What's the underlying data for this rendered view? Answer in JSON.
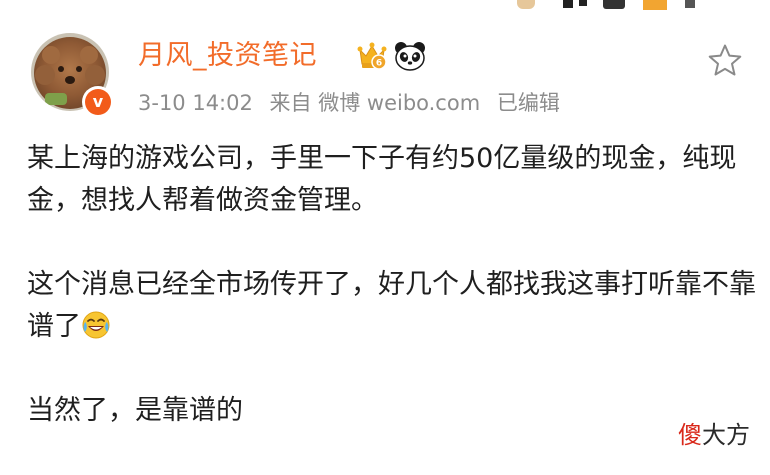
{
  "post": {
    "username": "月风_投资笔记",
    "meta": {
      "time": "3-10 14:02",
      "source": "来自 微博 weibo.com",
      "edited": "已编辑"
    },
    "verified_badge_text": "v",
    "paragraphs": [
      {
        "text": "某上海的游戏公司，手里一下子有约50亿量级的现金，纯现金，想找人帮着做资金管理。"
      },
      {
        "text": "这个消息已经全市场传开了，好几个人都找我这事打听靠不靠谱了",
        "emoji": "laughing-tears-emoji"
      },
      {
        "text": "当然了，是靠谱的"
      }
    ]
  },
  "watermark": {
    "part1": "傻",
    "part2": "大方"
  },
  "colors": {
    "username": "#f26c2a",
    "meta": "#8c8c8c",
    "body_text": "#1f1f1f",
    "verified": "#f25b1a",
    "watermark_red": "#d9281a"
  },
  "icons": {
    "favorite": "star-outline-icon",
    "vip": "vip-crown-badge-icon",
    "panda": "panda-badge-icon"
  }
}
